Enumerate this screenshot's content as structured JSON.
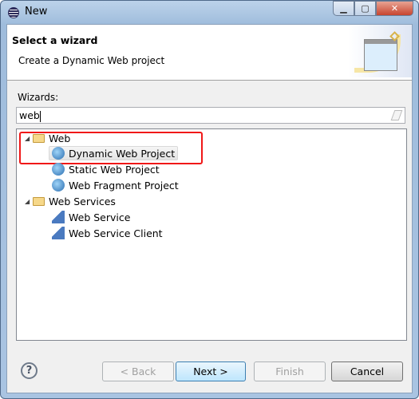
{
  "window": {
    "title": "New"
  },
  "header": {
    "title": "Select a wizard",
    "description": "Create a Dynamic Web project"
  },
  "wizards_label": "Wizards:",
  "filter": {
    "value": "web"
  },
  "tree": [
    {
      "label": "Web",
      "type": "category",
      "expanded": true
    },
    {
      "label": "Dynamic Web Project",
      "type": "item",
      "selected": true
    },
    {
      "label": "Static Web Project",
      "type": "item"
    },
    {
      "label": "Web Fragment Project",
      "type": "item"
    },
    {
      "label": "Web Services",
      "type": "category",
      "expanded": true
    },
    {
      "label": "Web Service",
      "type": "item"
    },
    {
      "label": "Web Service Client",
      "type": "item"
    }
  ],
  "buttons": {
    "help": "?",
    "back": "< Back",
    "next": "Next >",
    "finish": "Finish",
    "cancel": "Cancel"
  },
  "highlight_color": "#f01818"
}
